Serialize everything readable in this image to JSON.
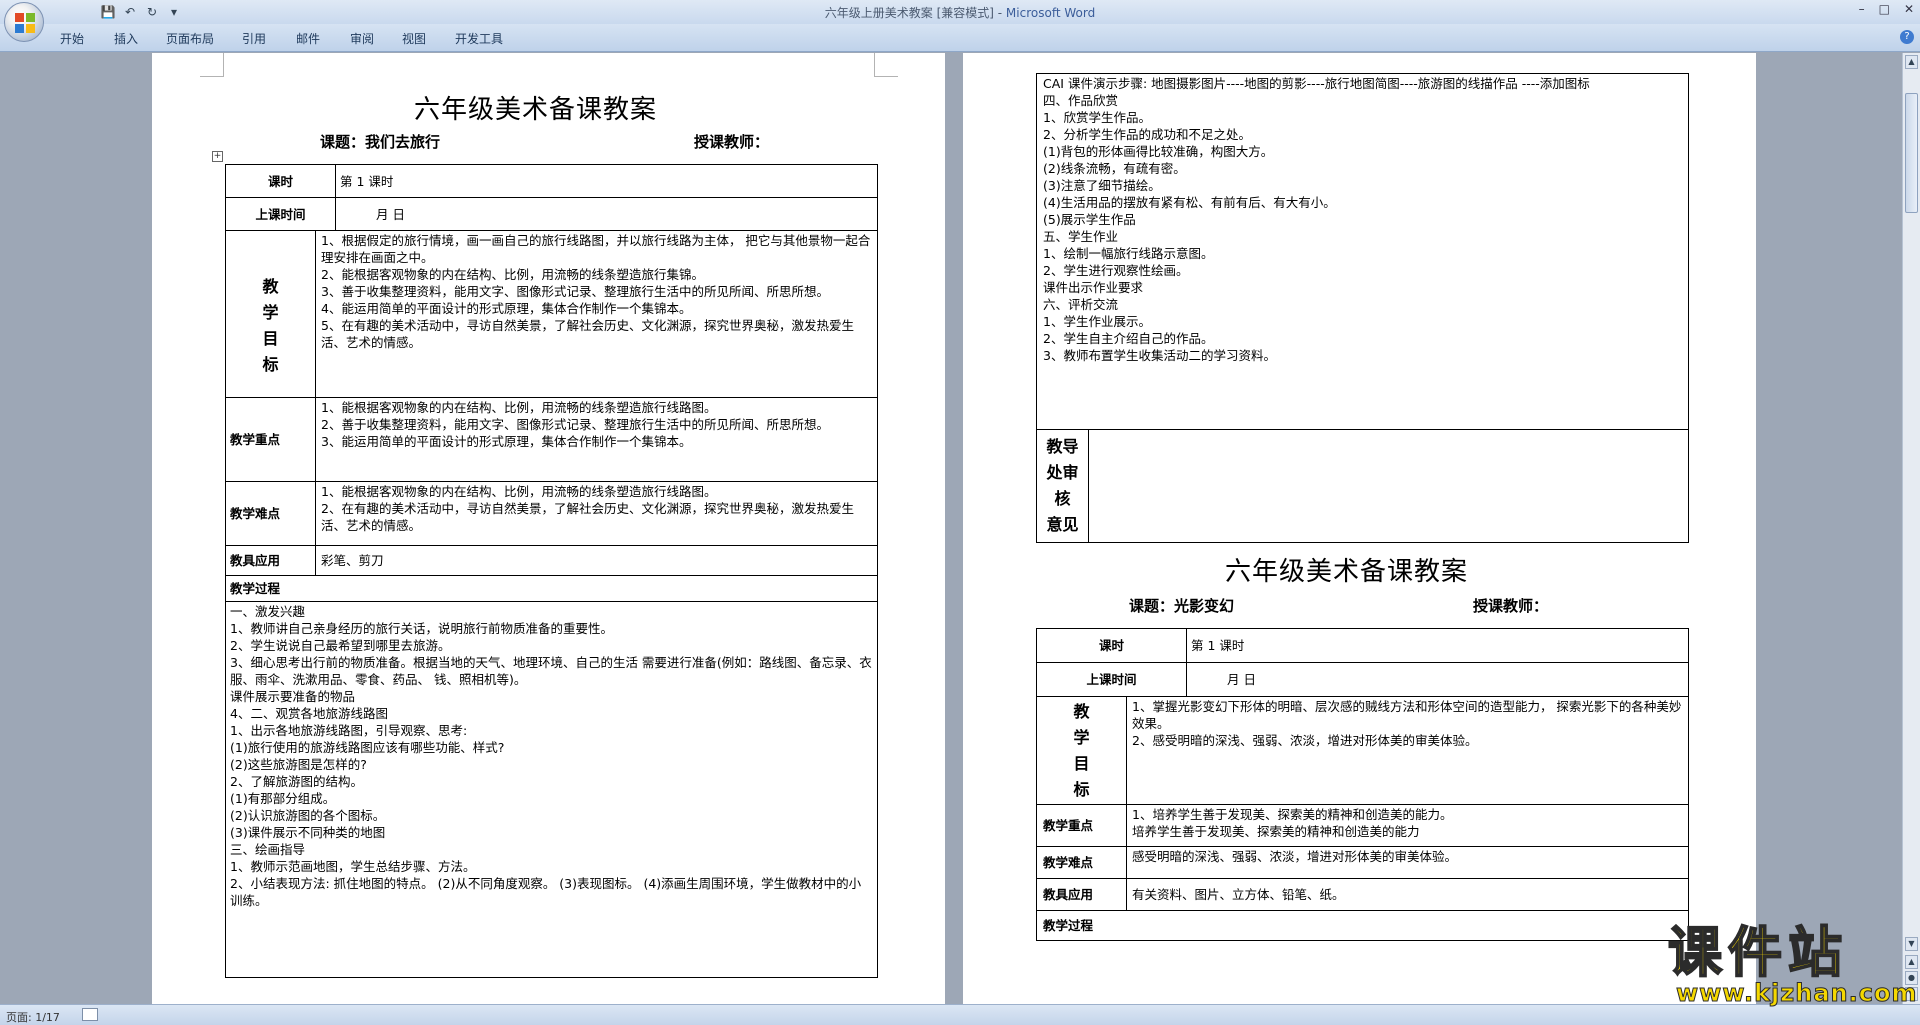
{
  "window": {
    "title": "六年级上册美术教案 [兼容模式] - ",
    "app": "Microsoft Word"
  },
  "ribbon": {
    "tabs": [
      "开始",
      "插入",
      "页面布局",
      "引用",
      "邮件",
      "审阅",
      "视图",
      "开发工具"
    ]
  },
  "status": {
    "page": "页面: 1/17"
  },
  "watermark": {
    "main": "课件站",
    "url": "www.kjzhan.com"
  },
  "lesson1": {
    "title": "六年级美术备课教案",
    "topic": "课题：我们去旅行",
    "teacher": "授课教师：",
    "label_period": "课时",
    "period_value": "第  1  课时",
    "label_time": "上课时间",
    "time_value": "月      日",
    "label_goals_chars": [
      "教",
      "学",
      "目",
      "标"
    ],
    "goals": [
      "1、根据假定的旅行情境，画一画自己的旅行线路图，并以旅行线路为主体，  把它与其他景物一起合理安排在画面之中。",
      "2、能根据客观物象的内在结构、比例，用流畅的线条塑造旅行集锦。",
      "3、善于收集整理资料，能用文字、图像形式记录、整理旅行生活中的所见所闻、所思所想。",
      "4、能运用简单的平面设计的形式原理，集体合作制作一个集锦本。",
      "5、在有趣的美术活动中，寻访自然美景，了解社会历史、文化渊源，探究世界奥秘，激发热爱生活、艺术的情感。"
    ],
    "label_key": "教学重点",
    "key_points": [
      "1、能根据客观物象的内在结构、比例，用流畅的线条塑造旅行线路图。",
      "2、善于收集整理资料，能用文字、图像形式记录、整理旅行生活中的所见所闻、所思所想。",
      "3、能运用简单的平面设计的形式原理，集体合作制作一个集锦本。"
    ],
    "label_difficult": "教学难点",
    "difficult_points": [
      "1、能根据客观物象的内在结构、比例，用流畅的线条塑造旅行线路图。",
      "2、在有趣的美术活动中，寻访自然美景，了解社会历史、文化渊源，探究世界奥秘，激发热爱生活、艺术的情感。"
    ],
    "label_tools": "教具应用",
    "tools": "彩笔、剪刀",
    "label_process": "教学过程",
    "process": [
      "一、激发兴趣",
      "1、教师讲自己亲身经历的旅行关话，说明旅行前物质准备的重要性。",
      "2、学生说说自己最希望到哪里去旅游。",
      "3、细心思考出行前的物质准备。根据当地的天气、地理环境、自己的生活  需要进行准备(例如：路线图、备忘录、衣服、雨伞、洗漱用品、零食、药品、  钱、照相机等)。",
      "课件展示要准备的物品",
      "4、二、观赏各地旅游线路图",
      "1、出示各地旅游线路图，引导观察、思考:",
      "(1)旅行使用的旅游线路图应该有哪些功能、样式?",
      " (2)这些旅游图是怎样的?",
      "2、了解旅游图的结构。",
      "(1)有那部分组成。",
      "(2)认识旅游图的各个图标。",
      "(3)课件展示不同种类的地图",
      "三、绘画指导",
      "1、教师示范画地图，学生总结步骤、方法。",
      "2、小结表现方法:      抓住地图的特点。  (2)从不同角度观察。  (3)表现图标。  (4)添画生周围环境，学生做教材中的小训练。"
    ],
    "process_cont": [
      "CAI 课件演示步骤:      地图摄影图片----地图的剪影----旅行地图简图----旅游图的线描作品  ----添加图标",
      "四、作品欣赏",
      "1、欣赏学生作品。",
      "2、分析学生作品的成功和不足之处。",
      "(1)背包的形体画得比较准确，构图大方。",
      "(2)线条流畅，有疏有密。",
      "(3)注意了细节描绘。",
      "(4)生活用品的摆放有紧有松、有前有后、有大有小。",
      "(5)展示学生作品",
      "五、学生作业",
      "1、绘制一幅旅行线路示意图。",
      "2、学生进行观察性绘画。",
      "课件出示作业要求",
      "六、评析交流",
      "1、学生作业展示。",
      "2、学生自主介绍自己的作品。",
      "3、教师布置学生收集活动二的学习资料。"
    ],
    "label_review_chars": [
      "教导",
      "处审",
      "核",
      "意见"
    ]
  },
  "lesson2": {
    "title": "六年级美术备课教案",
    "topic": "课题：光影变幻",
    "teacher": "授课教师：",
    "label_period": "课时",
    "period_value": "第  1  课时",
    "label_time": "上课时间",
    "time_value": "月      日",
    "label_goals_chars": [
      "教",
      "学",
      "目",
      "标"
    ],
    "goals": [
      "1、掌握光影变幻下形体的明暗、层次感的贼线方法和形体空间的造型能力，  探索光影下的各种美妙效果。",
      "2、感受明暗的深浅、强弱、浓淡，增进对形体美的审美体验。"
    ],
    "label_key": "教学重点",
    "key_points": [
      "1、培养学生善于发现美、探索美的精神和创造美的能力。",
      "培养学生善于发现美、探索美的精神和创造美的能力"
    ],
    "label_difficult": "教学难点",
    "difficult_points": [
      "感受明暗的深浅、强弱、浓淡，增进对形体美的审美体验。"
    ],
    "label_tools": "教具应用",
    "tools": "有关资料、图片、立方体、铅笔、纸。",
    "label_process": "教学过程"
  }
}
